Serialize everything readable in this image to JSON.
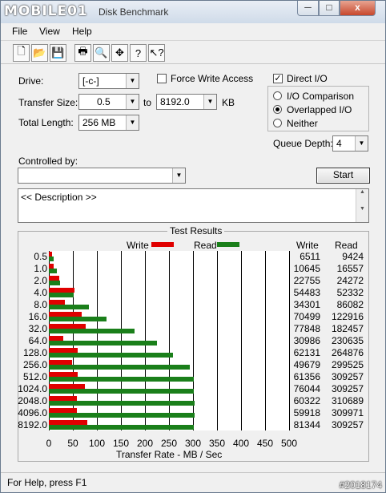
{
  "window": {
    "logo_text": "MOBILE01",
    "title": "Disk Benchmark",
    "min_label": "─",
    "max_label": "□",
    "close_label": "x"
  },
  "menu": {
    "file": "File",
    "view": "View",
    "help": "Help"
  },
  "toolbar_icons": [
    "new-icon",
    "open-icon",
    "save-icon",
    "print-icon",
    "print-preview-icon",
    "move-icon",
    "help-icon",
    "whats-this-icon"
  ],
  "form": {
    "drive_label": "Drive:",
    "drive_value": "[-c-]",
    "transfer_size_label": "Transfer Size:",
    "transfer_from": "0.5",
    "to_label": "to",
    "transfer_to": "8192.0",
    "kb_label": "KB",
    "total_length_label": "Total Length:",
    "total_length_value": "256 MB",
    "force_write_label": "Force Write Access",
    "force_write_checked": false,
    "direct_io_label": "Direct I/O",
    "direct_io_checked": true,
    "io_options": [
      {
        "label": "I/O Comparison",
        "selected": false
      },
      {
        "label": "Overlapped I/O",
        "selected": true
      },
      {
        "label": "Neither",
        "selected": false
      }
    ],
    "queue_depth_label": "Queue Depth:",
    "queue_depth_value": "4",
    "controlled_by_label": "Controlled by:",
    "controlled_by_value": "",
    "start_label": "Start",
    "description_text": "<< Description >>"
  },
  "results": {
    "title": "Test Results",
    "write_legend": "Write",
    "read_legend": "Read",
    "write_header": "Write",
    "read_header": "Read",
    "x_axis_label": "Transfer Rate - MB / Sec",
    "colors": {
      "write": "#e00000",
      "read": "#1a7f1a"
    }
  },
  "chart_data": {
    "type": "bar",
    "orientation": "horizontal",
    "categories": [
      "0.5",
      "1.0",
      "2.0",
      "4.0",
      "8.0",
      "16.0",
      "32.0",
      "64.0",
      "128.0",
      "256.0",
      "512.0",
      "1024.0",
      "2048.0",
      "4096.0",
      "8192.0"
    ],
    "series": [
      {
        "name": "Write",
        "values": [
          6511,
          10645,
          22755,
          54483,
          34301,
          70499,
          77848,
          30986,
          62131,
          49679,
          61356,
          76044,
          60322,
          59918,
          81344
        ]
      },
      {
        "name": "Read",
        "values": [
          9424,
          16557,
          24272,
          52332,
          86082,
          122916,
          182457,
          230635,
          264876,
          299525,
          309257,
          309257,
          310689,
          309971,
          309257
        ]
      }
    ],
    "xlabel": "Transfer Rate - MB / Sec",
    "xlim": [
      0,
      500
    ],
    "xticks": [
      "0",
      "50",
      "100",
      "150",
      "200",
      "250",
      "300",
      "350",
      "400",
      "450",
      "500"
    ],
    "value_units": "KB/s"
  },
  "status": {
    "text": "For Help, press F1",
    "watermark": "#2018174"
  }
}
